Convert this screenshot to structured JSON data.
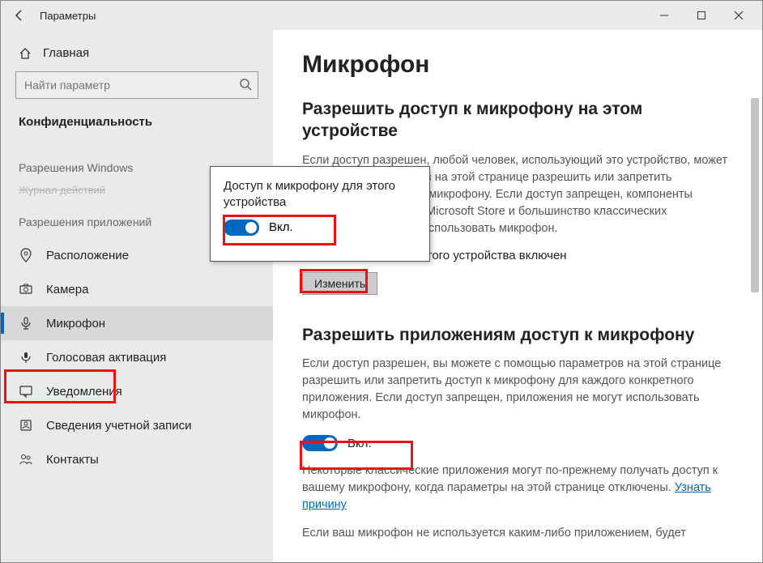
{
  "titlebar": {
    "title": "Параметры"
  },
  "sidebar": {
    "home": "Главная",
    "search_placeholder": "Найти параметр",
    "section": "Конфиденциальность",
    "group_windows": "Разрешения Windows",
    "trunc_line": "Журнал действий",
    "group_apps": "Разрешения приложений",
    "items": {
      "location": "Расположение",
      "camera": "Камера",
      "microphone": "Микрофон",
      "voice": "Голосовая активация",
      "notifications": "Уведомления",
      "account": "Сведения учетной записи",
      "contacts": "Контакты"
    }
  },
  "content": {
    "title": "Микрофон",
    "section1_title": "Разрешить доступ к микрофону на этом устройстве",
    "section1_body": "Если доступ разрешен, любой человек, использующий это устройство, может с помощью параметров на этой странице разрешить или запретить приложениям доступ к микрофону. Если доступ запрещен, компоненты Windows, приложения Microsoft Store и большинство классических приложений не могут использовать микрофон.",
    "device_status": "Доступ к микрофону этого устройства включен",
    "change_btn": "Изменить",
    "section2_title": "Разрешить приложениям доступ к микрофону",
    "section2_body": "Если доступ разрешен, вы можете с помощью параметров на этой странице разрешить или запретить доступ к микрофону для каждого конкретного приложения. Если доступ запрещен, приложения не могут использовать микрофон.",
    "toggle_on": "Вкл.",
    "note_classic": "Некоторые классические приложения могут по-прежнему получать доступ к вашему микрофону, когда параметры на этой странице отключены. ",
    "learn_why": "Узнать причину",
    "footer_partial": "Если ваш микрофон не используется каким-либо приложением, будет"
  },
  "popup": {
    "title": "Доступ к микрофону для этого устройства",
    "toggle_label": "Вкл."
  }
}
